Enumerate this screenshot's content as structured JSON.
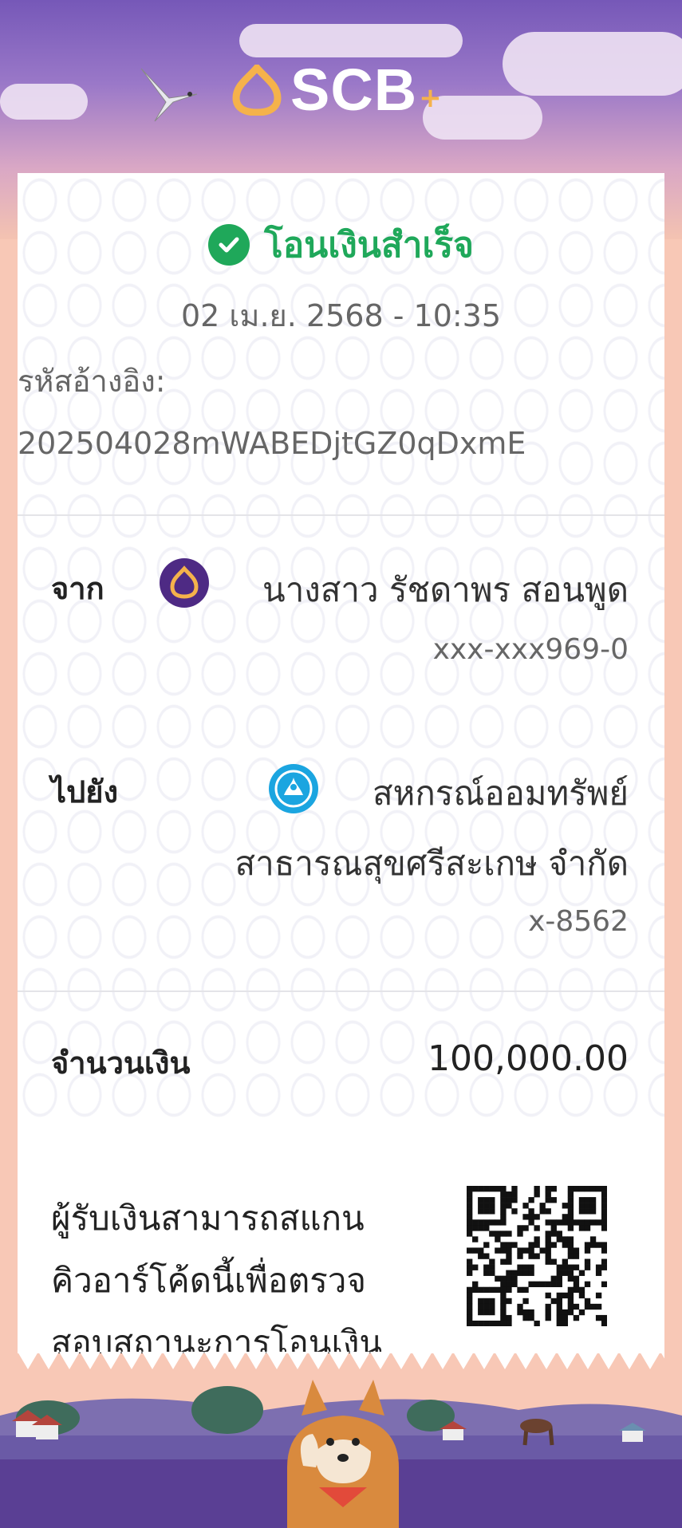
{
  "header": {
    "brand": "SCB",
    "brand_plus": "+",
    "colors": {
      "sky_top": "#7658b8",
      "sky_bottom": "#f4c3b1",
      "brand_gold": "#f5b24b",
      "success_green": "#1fa85a",
      "page_bg": "#f8c8b6"
    }
  },
  "receipt": {
    "status_title": "โอนเงินสำเร็จ",
    "datetime": "02 เม.ย. 2568 - 10:35",
    "ref_label": "รหัสอ้างอิง:",
    "ref_value": "202504028mWABEDjtGZ0qDxmE",
    "from": {
      "label": "จาก",
      "name": "นางสาว รัชดาพร สอนพูด",
      "account": "xxx-xxx969-0",
      "bank_icon": "scb-bank-icon"
    },
    "to": {
      "label": "ไปยัง",
      "name_line1": "สหกรณ์ออมทรัพย์",
      "name_line2": "สาธารณสุขศรีสะเกษ จำกัด",
      "account": "x-8562",
      "bank_icon": "krungthai-bank-icon"
    },
    "amount": {
      "label": "จำนวนเงิน",
      "value": "100,000.00"
    },
    "qr_text_line1": "ผู้รับเงินสามารถสแกน",
    "qr_text_line2": "คิวอาร์โค้ดนี้เพื่อตรวจ",
    "qr_text_line3": "สอบสถานะการโอนเงิน"
  }
}
